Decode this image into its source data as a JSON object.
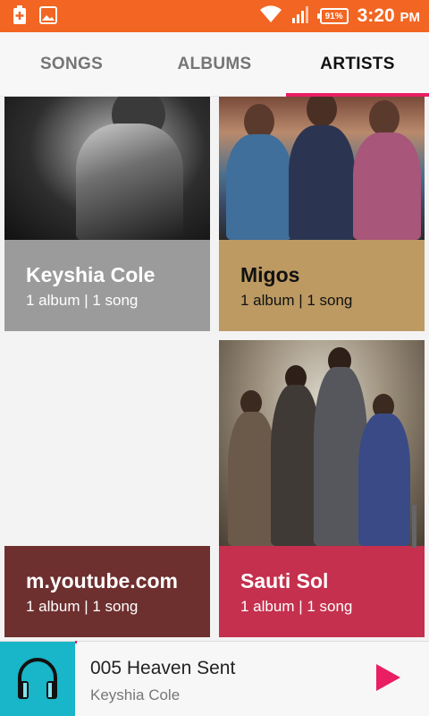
{
  "status_bar": {
    "battery_percent": "91%",
    "time": "3:20",
    "time_suffix": "PM",
    "background_color": "#f26522",
    "icons": [
      "battery-plus-icon",
      "image-icon",
      "wifi-icon",
      "signal-icon",
      "battery-icon"
    ]
  },
  "tabs": [
    {
      "label": "SONGS",
      "active": false
    },
    {
      "label": "ALBUMS",
      "active": false
    },
    {
      "label": "ARTISTS",
      "active": true
    }
  ],
  "accent_color": "#e91e63",
  "artists": [
    {
      "name": "Keyshia Cole",
      "meta": "1 album | 1 song",
      "color": "#9b9b9b"
    },
    {
      "name": "Migos",
      "meta": "1 album | 1 song",
      "color": "#bc9a62"
    },
    {
      "name": "m.youtube.com",
      "meta": "1 album | 1 song",
      "color": "#6e2f2f"
    },
    {
      "name": "Sauti Sol",
      "meta": "1 album | 1 song",
      "color": "#c4304d"
    }
  ],
  "now_playing": {
    "title": "005 Heaven Sent",
    "artist": "Keyshia Cole",
    "art_icon": "headphones-icon",
    "art_color": "#19b5c8",
    "play_icon": "play-icon"
  }
}
